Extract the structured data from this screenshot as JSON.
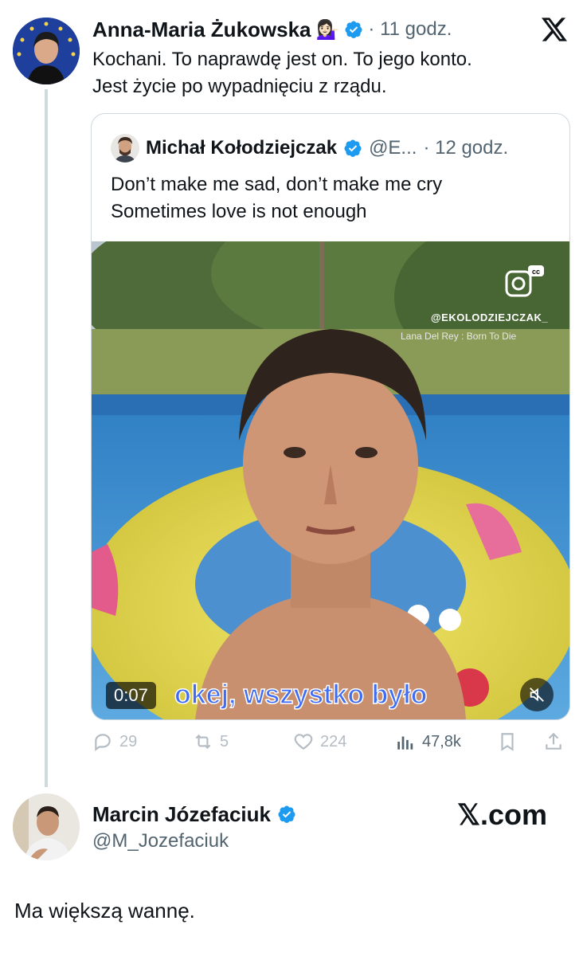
{
  "tweet": {
    "author_name": "Anna-Maria Żukowska",
    "emoji": "💁🏻‍♀️",
    "time": "· 11 godz.",
    "text_line1": "Kochani. To naprawdę jest on. To jego konto.",
    "text_line2": "Jest życie po wypadnięciu z rządu."
  },
  "quote": {
    "author_name": "Michał Kołodziejczak",
    "handle": "@E...",
    "time": "· 12 godz.",
    "text_line1": "Don’t make me sad, don’t make me cry",
    "text_line2": "Sometimes love is not enough",
    "video": {
      "duration": "0:07",
      "caption": "okej, wszystko było",
      "watermark_handle": "@EKOLODZIEJCZAK_",
      "song": "Lana Del Rey : Born To Die"
    },
    "stats": {
      "replies": "29",
      "reposts": "5",
      "likes": "224",
      "views": "47,8k"
    }
  },
  "reply": {
    "author_name": "Marcin Józefaciuk",
    "handle": "@M_Jozefaciuk",
    "brand": "𝕏.com",
    "text": "Ma większą wannę."
  },
  "colors": {
    "verified": "#1d9bf0",
    "text": "#0f1419",
    "secondary": "#536471",
    "caption": "#3f6cf2"
  }
}
